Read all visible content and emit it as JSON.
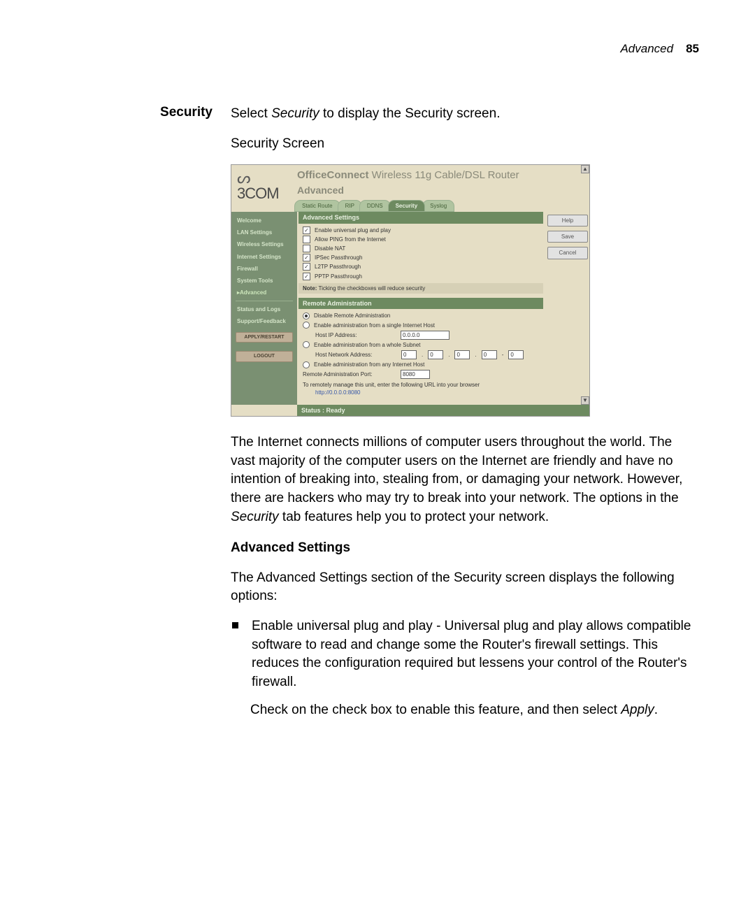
{
  "header": {
    "title": "Advanced",
    "page_number": "85"
  },
  "sidebar_label": "Security",
  "intro_before_em": "Select ",
  "intro_em": "Security",
  "intro_after_em": " to display the Security screen.",
  "caption": "Security Screen",
  "screenshot": {
    "product_title_bold": "OfficeConnect",
    "product_title_rest": " Wireless 11g Cable/DSL Router",
    "section": "Advanced",
    "logo_text": "3COM",
    "tabs": [
      "Static Route",
      "RIP",
      "DDNS",
      "Security",
      "Syslog"
    ],
    "active_tab_index": 3,
    "side_items": [
      "Welcome",
      "LAN Settings",
      "Wireless Settings",
      "Internet Settings",
      "Firewall",
      "System Tools",
      "Advanced"
    ],
    "active_side_index": 6,
    "side_items2": [
      "Status and Logs",
      "Support/Feedback"
    ],
    "side_buttons": [
      "APPLY/RESTART",
      "LOGOUT"
    ],
    "panel_adv": {
      "title": "Advanced Settings",
      "rows": [
        {
          "checked": true,
          "label": "Enable universal plug and play"
        },
        {
          "checked": false,
          "label": "Allow PING from the Internet"
        },
        {
          "checked": false,
          "label": "Disable NAT"
        },
        {
          "checked": true,
          "label": "IPSec Passthrough"
        },
        {
          "checked": true,
          "label": "L2TP Passthrough"
        },
        {
          "checked": true,
          "label": "PPTP Passthrough"
        }
      ],
      "note_label": "Note:",
      "note_text": " Ticking the checkboxes will reduce security"
    },
    "panel_remote": {
      "title": "Remote Administration",
      "opt_disable": "Disable Remote Administration",
      "opt_single": "Enable administration from a single Internet Host",
      "host_ip_label": "Host IP Address:",
      "host_ip_value": "0.0.0.0",
      "opt_subnet": "Enable administration from a whole Subnet",
      "host_net_label": "Host Network Address:",
      "net_segs": [
        "0",
        "0",
        "0",
        "0",
        "0"
      ],
      "opt_any": "Enable administration from any Internet Host",
      "port_label": "Remote Administration Port:",
      "port_value": "8080",
      "url_note": "To remotely manage this unit, enter the following URL into your browser",
      "url_link": "http://0.0.0.0:8080"
    },
    "right_buttons": [
      "Help",
      "Save",
      "Cancel"
    ],
    "status": "Status : Ready"
  },
  "para_before_em": "The Internet connects millions of computer users throughout the world. The vast majority of the computer users on the Internet are friendly and have no intention of breaking into, stealing from, or damaging your network. However, there are hackers who may try to break into your network. The options in the ",
  "para_em": "Security",
  "para_after_em": " tab features help you to protect your network.",
  "subheading": "Advanced Settings",
  "adv_intro": "The Advanced Settings section of the Security screen displays the following options:",
  "bullet1": "Enable universal plug and play - Universal plug and play allows compatible software to read and change some the Router's firewall settings. This reduces the configuration required but lessens your control of the Router's firewall.",
  "bullet1_after_before_em": "Check on the check box to enable this feature, and then select ",
  "bullet1_after_em": "Apply",
  "bullet1_after_end": "."
}
